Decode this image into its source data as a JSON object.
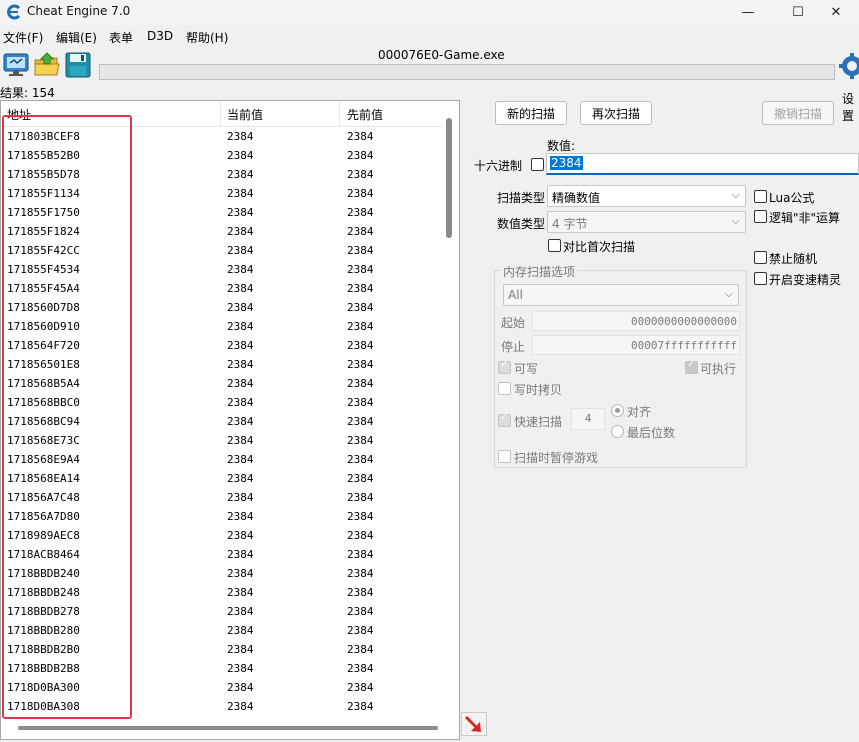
{
  "window": {
    "title": "Cheat Engine 7.0",
    "controls": {
      "minimize": "—",
      "maximize": "☐",
      "close": "✕"
    }
  },
  "menu": [
    "文件(F)",
    "编辑(E)",
    "表单",
    "D3D",
    "帮助(H)"
  ],
  "toolbar": {
    "process_title": "000076E0-Game.exe",
    "settings_label": "设置"
  },
  "results": {
    "count_label": "结果: 154",
    "columns": [
      "地址",
      "当前值",
      "先前值"
    ],
    "rows": [
      {
        "address": "171803BCEF8",
        "current": "2384",
        "previous": "2384"
      },
      {
        "address": "171855B52B0",
        "current": "2384",
        "previous": "2384"
      },
      {
        "address": "171855B5D78",
        "current": "2384",
        "previous": "2384"
      },
      {
        "address": "171855F1134",
        "current": "2384",
        "previous": "2384"
      },
      {
        "address": "171855F1750",
        "current": "2384",
        "previous": "2384"
      },
      {
        "address": "171855F1824",
        "current": "2384",
        "previous": "2384"
      },
      {
        "address": "171855F42CC",
        "current": "2384",
        "previous": "2384"
      },
      {
        "address": "171855F4534",
        "current": "2384",
        "previous": "2384"
      },
      {
        "address": "171855F45A4",
        "current": "2384",
        "previous": "2384"
      },
      {
        "address": "1718560D7D8",
        "current": "2384",
        "previous": "2384"
      },
      {
        "address": "1718560D910",
        "current": "2384",
        "previous": "2384"
      },
      {
        "address": "1718564F720",
        "current": "2384",
        "previous": "2384"
      },
      {
        "address": "171856501E8",
        "current": "2384",
        "previous": "2384"
      },
      {
        "address": "1718568B5A4",
        "current": "2384",
        "previous": "2384"
      },
      {
        "address": "1718568BBC0",
        "current": "2384",
        "previous": "2384"
      },
      {
        "address": "1718568BC94",
        "current": "2384",
        "previous": "2384"
      },
      {
        "address": "1718568E73C",
        "current": "2384",
        "previous": "2384"
      },
      {
        "address": "1718568E9A4",
        "current": "2384",
        "previous": "2384"
      },
      {
        "address": "1718568EA14",
        "current": "2384",
        "previous": "2384"
      },
      {
        "address": "171856A7C48",
        "current": "2384",
        "previous": "2384"
      },
      {
        "address": "171856A7D80",
        "current": "2384",
        "previous": "2384"
      },
      {
        "address": "1718989AEC8",
        "current": "2384",
        "previous": "2384"
      },
      {
        "address": "1718ACB8464",
        "current": "2384",
        "previous": "2384"
      },
      {
        "address": "1718BBDB240",
        "current": "2384",
        "previous": "2384"
      },
      {
        "address": "1718BBDB248",
        "current": "2384",
        "previous": "2384"
      },
      {
        "address": "1718BBDB278",
        "current": "2384",
        "previous": "2384"
      },
      {
        "address": "1718BBDB280",
        "current": "2384",
        "previous": "2384"
      },
      {
        "address": "1718BBDB2B0",
        "current": "2384",
        "previous": "2384"
      },
      {
        "address": "1718BBDB2B8",
        "current": "2384",
        "previous": "2384"
      },
      {
        "address": "1718D0BA300",
        "current": "2384",
        "previous": "2384"
      },
      {
        "address": "1718D0BA308",
        "current": "2384",
        "previous": "2384"
      }
    ]
  },
  "scan": {
    "new_scan": "新的扫描",
    "next_scan": "再次扫描",
    "undo_scan": "撤销扫描",
    "value_label": "数值:",
    "hex_label": "十六进制",
    "value": "2384",
    "scan_type_label": "扫描类型",
    "scan_type_value": "精确数值",
    "value_type_label": "数值类型",
    "value_type_value": "4 字节",
    "compare_first_label": "对比首次扫描",
    "lua_label": "Lua公式",
    "not_label": "逻辑\"非\"运算",
    "no_random_label": "禁止随机",
    "speedhack_label": "开启变速精灵"
  },
  "memory_options": {
    "title": "内存扫描选项",
    "region_value": "All",
    "start_label": "起始",
    "start_value": "0000000000000000",
    "stop_label": "停止",
    "stop_value": "00007fffffffffff",
    "writable_label": "可写",
    "executable_label": "可执行",
    "copy_on_write_label": "写时拷贝",
    "fast_scan_label": "快速扫描",
    "fast_scan_value": "4",
    "align_label": "对齐",
    "last_digits_label": "最后位数",
    "pause_label": "扫描时暂停游戏"
  },
  "colors": {
    "highlight": "#e0384a",
    "selection": "#0078d7"
  }
}
